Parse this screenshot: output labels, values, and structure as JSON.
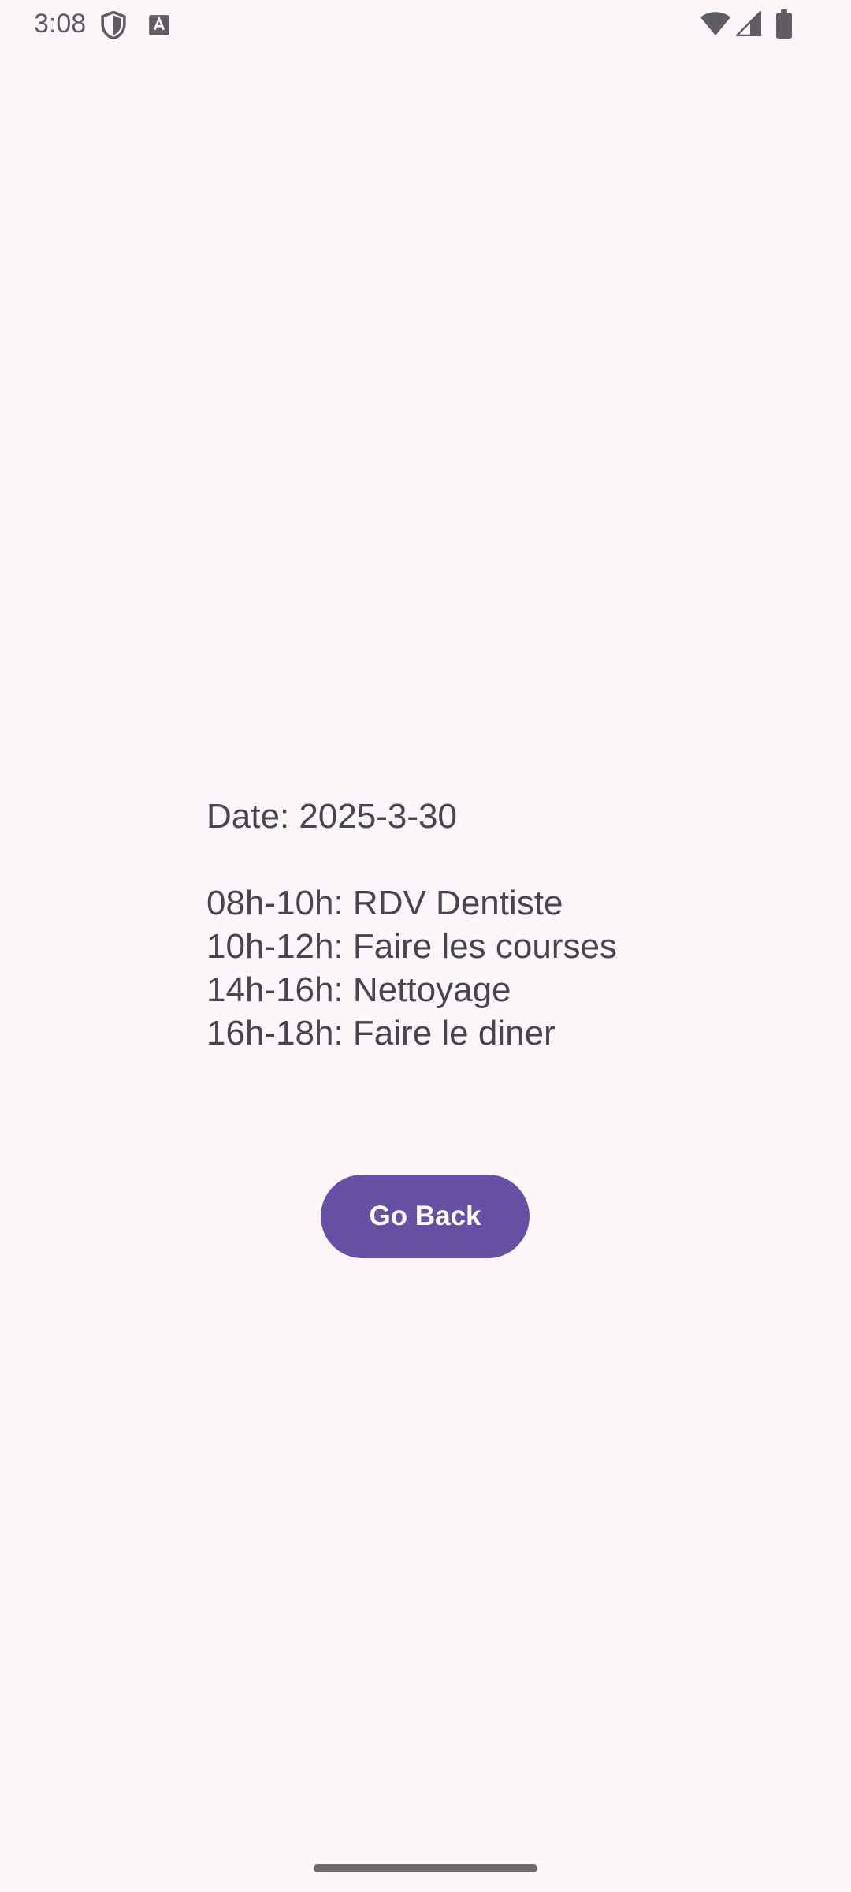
{
  "status_bar": {
    "time": "3:08",
    "icons": [
      "shield-icon",
      "keyboard-icon",
      "wifi-icon",
      "signal-icon",
      "battery-icon"
    ]
  },
  "schedule": {
    "date_line": "Date: 2025-3-30",
    "entries": [
      "08h-10h: RDV Dentiste",
      "10h-12h: Faire les courses",
      "14h-16h: Nettoyage",
      "16h-18h: Faire le diner"
    ]
  },
  "actions": {
    "go_back_label": "Go Back"
  },
  "colors": {
    "background": "#fdf7fc",
    "text": "#49454f",
    "button": "#6750a4",
    "button_text": "#ffffff"
  }
}
